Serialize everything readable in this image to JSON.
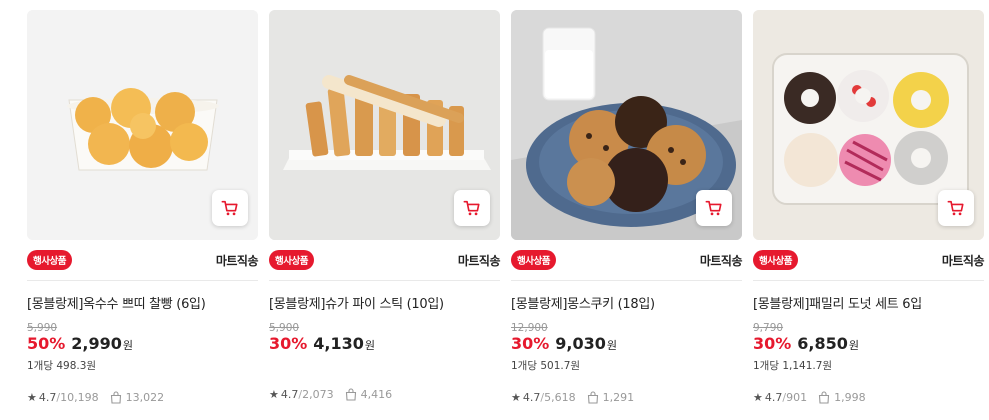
{
  "colors": {
    "accent": "#e6192e",
    "text": "#222222",
    "muted": "#999999"
  },
  "products": [
    {
      "badge": "행사상품",
      "delivery": "마트직송",
      "title": "[몽블랑제]옥수수 쁘띠 찰빵 (6입)",
      "original_price": "5,990",
      "discount": "50%",
      "price": "2,990",
      "currency": "원",
      "unit_price": "1개당 498.3원",
      "rating": "4.7",
      "review_count": "10,198",
      "buy_count": "13,022",
      "image_icon": "corn-bread-icon"
    },
    {
      "badge": "행사상품",
      "delivery": "마트직송",
      "title": "[몽블랑제]슈가 파이 스틱 (10입)",
      "original_price": "5,900",
      "discount": "30%",
      "price": "4,130",
      "currency": "원",
      "unit_price": "",
      "rating": "4.7",
      "review_count": "2,073",
      "buy_count": "4,416",
      "image_icon": "pie-stick-icon"
    },
    {
      "badge": "행사상품",
      "delivery": "마트직송",
      "title": "[몽블랑제]몽스쿠키 (18입)",
      "original_price": "12,900",
      "discount": "30%",
      "price": "9,030",
      "currency": "원",
      "unit_price": "1개당 501.7원",
      "rating": "4.7",
      "review_count": "5,618",
      "buy_count": "1,291",
      "image_icon": "cookie-icon"
    },
    {
      "badge": "행사상품",
      "delivery": "마트직송",
      "title": "[몽블랑제]패밀리 도넛 세트 6입",
      "original_price": "9,790",
      "discount": "30%",
      "price": "6,850",
      "currency": "원",
      "unit_price": "1개당 1,141.7원",
      "rating": "4.7",
      "review_count": "901",
      "buy_count": "1,998",
      "image_icon": "donut-icon"
    }
  ]
}
